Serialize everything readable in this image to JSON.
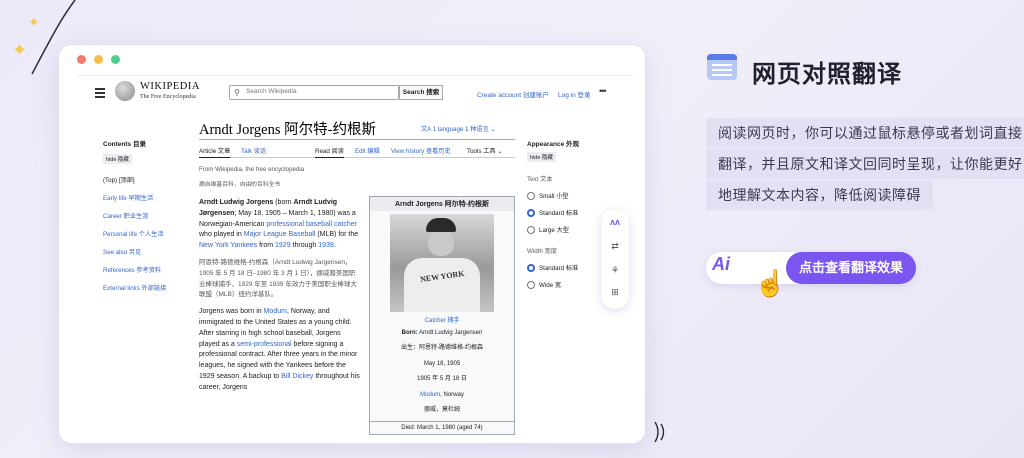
{
  "wiki": {
    "wordmark": "WIKIPEDIA",
    "tagline": "The Free Encyclopedia",
    "search_placeholder": "Search Wikipedia",
    "search_button": "Search 搜索",
    "create_account": "Create account 创建账户",
    "login": "Log in 登录"
  },
  "toc": {
    "title": "Contents 目录",
    "hide": "hide 隐藏",
    "items": [
      "(Top) [顶部]",
      "Early life 早期生活",
      "Career 职业生涯",
      "Personal life 个人生活",
      "See also 另见",
      "References 参考资料",
      "External links 外部链接"
    ]
  },
  "article": {
    "title": "Arndt Jorgens 阿尔特-约根斯",
    "language": "1 language 1 种语言",
    "tabs": {
      "article": "Article 文章",
      "talk": "Talk 谈话",
      "read": "Read 阅读",
      "edit": "Edit 编辑",
      "history": "View history 查看历史",
      "tools": "Tools 工具"
    },
    "from": "From Wikipedia, the free encyclopedia",
    "from_zh": "摘自维基百科，自由的百科全书",
    "p1_a": "Arndt Ludwig Jorgens",
    "p1_b": " (born ",
    "p1_c": "Arndt Ludvig Jørgensen",
    "p1_d": "; May 18, 1905 – March 1, 1980) was a Norwegian-American ",
    "p1_link1": "professional baseball catcher",
    "p1_e": " who played in ",
    "p1_link2": "Major League Baseball",
    "p1_f": " (MLB) for the ",
    "p1_link3": "New York Yankees",
    "p1_g": " from ",
    "p1_link4": "1929",
    "p1_h": " through ",
    "p1_link5": "1939",
    "p1_i": ".",
    "p1_zh": "阿恩特-路德维格-约根森（Arndt Ludwig Jargensen，1905 年 5 月 18 日–1980 年 3 月 1 日），挪威裔美国职业棒球捕手，1929 年至 1939 年效力于美国职业棒球大联盟（MLB）纽约洋基队。",
    "p2_a": "Jorgens was born in ",
    "p2_link1": "Modum",
    "p2_b": ", Norway, and immigrated to the United States as a young child. After starring in high school baseball, Jorgens played as a ",
    "p2_link2": "semi-professional",
    "p2_c": " before signing a professional contract. After three years in the minor leagues, he signed with the Yankees before the 1929 season. A backup to ",
    "p2_link3": "Bill Dickey",
    "p2_d": " throughout his career, Jorgens"
  },
  "infobox": {
    "title": "Arndt Jorgens 阿尔特-约根斯",
    "caption": "Catcher 捕手",
    "born_label": "Born:",
    "born_value": "Arndt Ludvig Jargensen",
    "born_zh": "出生：阿恩特-路德维格-约根森",
    "birth_date": "May 18, 1905",
    "birth_date_zh": "1905 年 5 月 18 日",
    "birthplace_link": "Modum",
    "birthplace_rest": ", Norway",
    "birthplace_zh": "挪威，莫杜姆",
    "died": "Died: March 1, 1980 (aged 74)"
  },
  "appearance": {
    "title": "Appearance 外观",
    "hide": "hide 隐藏",
    "text_label": "Text 文本",
    "text_options": [
      "Small 小型",
      "Standard 标准",
      "Large 大型"
    ],
    "text_selected": 1,
    "width_label": "Width 宽度",
    "width_options": [
      "Standard 标准",
      "Wide 宽"
    ],
    "width_selected": 0
  },
  "feature": {
    "title": "网页对照翻译",
    "lines": [
      "阅读网页时，你可以通过鼠标悬停或者划词直接",
      "翻译，并且原文和译文回同时呈现，让你能更好",
      "地理解文本内容，降低阅读障碍"
    ],
    "cta_logo": "Ai",
    "cta_label": "点击查看翻译效果"
  },
  "colors": {
    "accent": "#7a55f0",
    "link": "#3366cc",
    "background": "#eceaf8"
  }
}
